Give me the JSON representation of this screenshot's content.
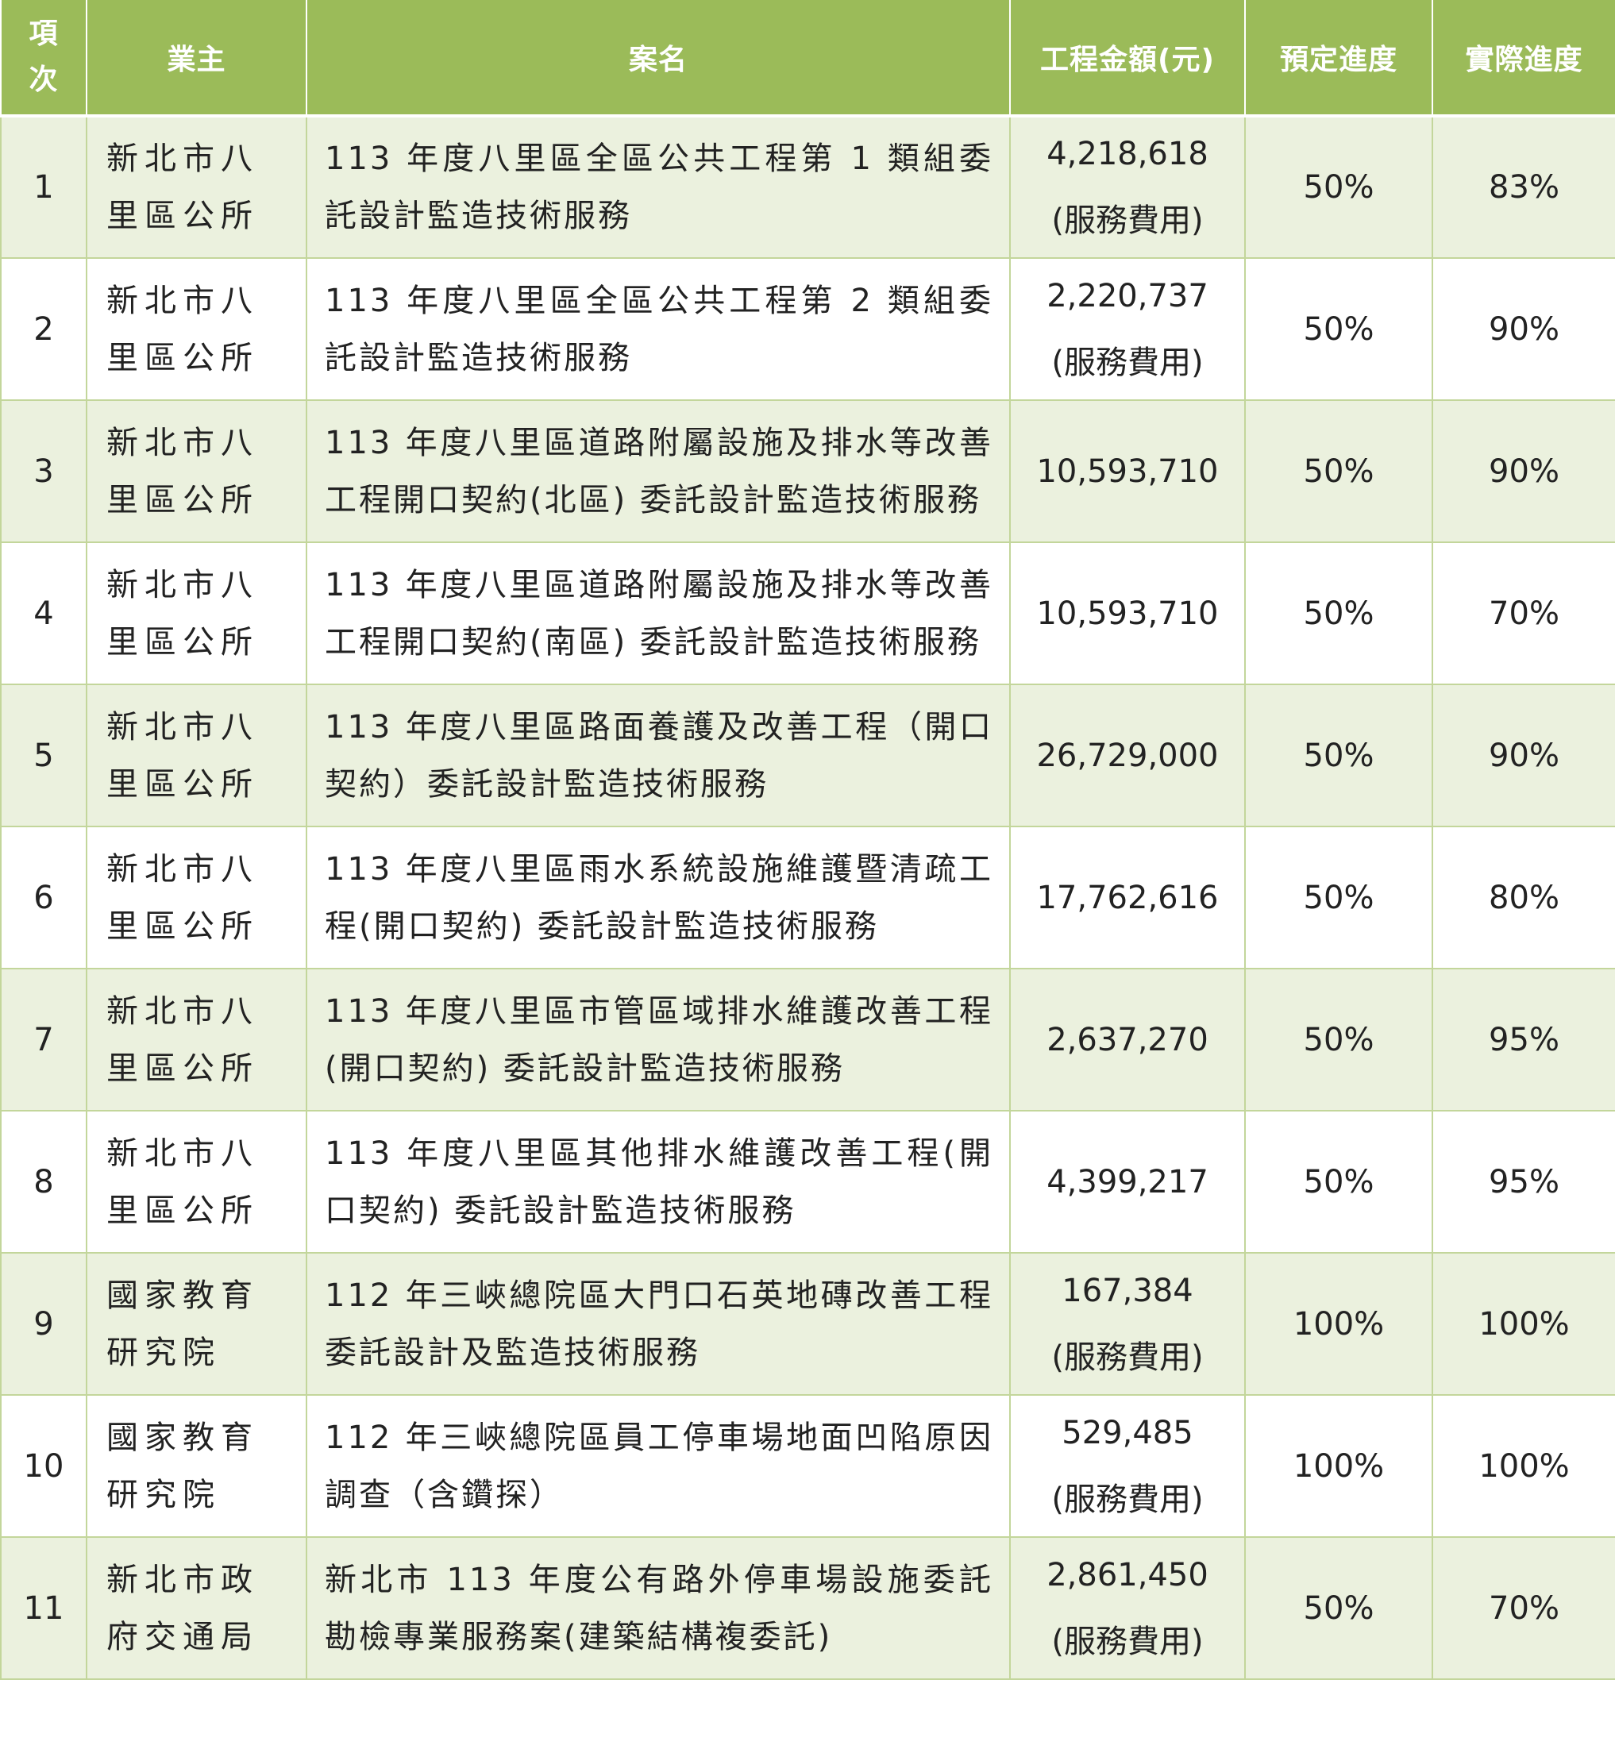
{
  "headers": {
    "no_line1": "項",
    "no_line2": "次",
    "owner": "業主",
    "name": "案名",
    "amount": "工程金額(元)",
    "planned": "預定進度",
    "actual": "實際進度"
  },
  "rows": [
    {
      "no": "1",
      "owner": "新北市八里區公所",
      "name": "113 年度八里區全區公共工程第 1 類組委託設計監造技術服務",
      "amount": "4,218,618",
      "note": "(服務費用)",
      "planned": "50%",
      "actual": "83%"
    },
    {
      "no": "2",
      "owner": "新北市八里區公所",
      "name": "113 年度八里區全區公共工程第 2 類組委託設計監造技術服務",
      "amount": "2,220,737",
      "note": "(服務費用)",
      "planned": "50%",
      "actual": "90%"
    },
    {
      "no": "3",
      "owner": "新北市八里區公所",
      "name": "113 年度八里區道路附屬設施及排水等改善工程開口契約(北區) 委託設計監造技術服務",
      "amount": "10,593,710",
      "note": "",
      "planned": "50%",
      "actual": "90%"
    },
    {
      "no": "4",
      "owner": "新北市八里區公所",
      "name": "113 年度八里區道路附屬設施及排水等改善工程開口契約(南區) 委託設計監造技術服務",
      "amount": "10,593,710",
      "note": "",
      "planned": "50%",
      "actual": "70%"
    },
    {
      "no": "5",
      "owner": "新北市八里區公所",
      "name": "113 年度八里區路面養護及改善工程（開口契約）委託設計監造技術服務",
      "amount": "26,729,000",
      "note": "",
      "planned": "50%",
      "actual": "90%"
    },
    {
      "no": "6",
      "owner": "新北市八里區公所",
      "name": "113 年度八里區雨水系統設施維護暨清疏工程(開口契約) 委託設計監造技術服務",
      "amount": "17,762,616",
      "note": "",
      "planned": "50%",
      "actual": "80%"
    },
    {
      "no": "7",
      "owner": "新北市八里區公所",
      "name": "113 年度八里區市管區域排水維護改善工程(開口契約) 委託設計監造技術服務",
      "amount": "2,637,270",
      "note": "",
      "planned": "50%",
      "actual": "95%"
    },
    {
      "no": "8",
      "owner": "新北市八里區公所",
      "name": "113 年度八里區其他排水維護改善工程(開口契約) 委託設計監造技術服務",
      "amount": "4,399,217",
      "note": "",
      "planned": "50%",
      "actual": "95%"
    },
    {
      "no": "9",
      "owner": "國家教育研究院",
      "name": "112 年三峽總院區大門口石英地磚改善工程委託設計及監造技術服務",
      "amount": "167,384",
      "note": "(服務費用)",
      "planned": "100%",
      "actual": "100%"
    },
    {
      "no": "10",
      "owner": "國家教育研究院",
      "name": "112 年三峽總院區員工停車場地面凹陷原因調查（含鑽探）",
      "amount": "529,485",
      "note": "(服務費用)",
      "planned": "100%",
      "actual": "100%"
    },
    {
      "no": "11",
      "owner": "新北市政府交通局",
      "name": "新北市 113 年度公有路外停車場設施委託勘檢專業服務案(建築結構複委託)",
      "amount": "2,861,450",
      "note": "(服務費用)",
      "planned": "50%",
      "actual": "70%"
    }
  ],
  "colors": {
    "header_bg": "#9bbb59",
    "stripe_bg": "#ebf1de",
    "border": "#c3d69b"
  }
}
